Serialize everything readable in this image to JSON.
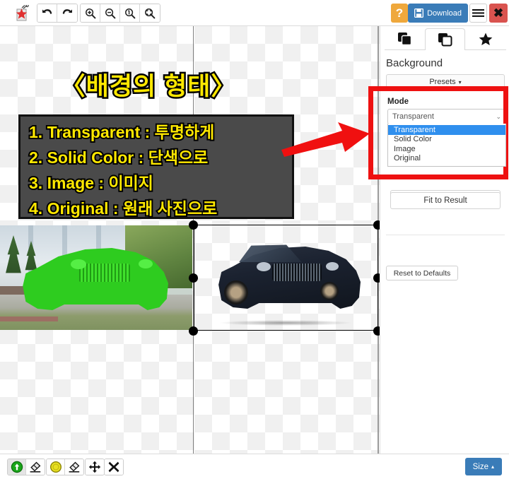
{
  "app": {
    "logo_icon": "magic-wand-star-icon"
  },
  "top_toolbar": {
    "undo": {
      "label": "Undo",
      "icon": "undo-arrow-icon"
    },
    "redo": {
      "label": "Redo",
      "icon": "redo-arrow-icon"
    },
    "zoom_in": {
      "label": "Zoom In",
      "icon": "magnifier-plus-icon"
    },
    "zoom_out": {
      "label": "Zoom Out",
      "icon": "magnifier-minus-icon"
    },
    "zoom_actual": {
      "label": "Actual Size",
      "icon": "magnifier-one-icon"
    },
    "zoom_fit": {
      "label": "Fit to Screen",
      "icon": "magnifier-fit-icon"
    },
    "help_label": "?",
    "download_label": "Download",
    "download_icon": "floppy-disk-icon",
    "menu_icon": "hamburger-menu-icon",
    "close_label": "✖"
  },
  "overlay": {
    "title": "〈배경의 형태〉",
    "lines": [
      "1. Transparent : 투명하게",
      "2. Solid Color : 단색으로",
      "3. Image : 이미지",
      "4. Original : 원래 사진으로"
    ],
    "arrow_icon": "red-arrow-right-icon",
    "text_color": "#ffe800",
    "box_color": "#4a4a4a",
    "highlight_color": "#ee1111"
  },
  "canvas": {
    "left_pane_name": "original-image-with-green-mask",
    "right_pane_name": "result-image-transparent-background"
  },
  "right_panel": {
    "tabs": [
      {
        "name": "tab-erase",
        "icon": "layers-filled-icon",
        "active": false
      },
      {
        "name": "tab-background",
        "icon": "layers-outline-icon",
        "active": true
      },
      {
        "name": "tab-effects",
        "icon": "star-icon",
        "active": false
      }
    ],
    "heading": "Background",
    "presets_label": "Presets",
    "presets_caret": "▾",
    "mode": {
      "label": "Mode",
      "value": "Transparent",
      "caret": "⌄",
      "options": [
        "Transparent",
        "Solid Color",
        "Image",
        "Original"
      ],
      "selected_index": 0,
      "selected_bg": "#2f8fee"
    },
    "fit_to_result_label": "Fit to Result",
    "reset_label": "Reset to Defaults"
  },
  "bottom_toolbar": {
    "tools": [
      {
        "name": "restore-brush",
        "icon": "green-plus-circle-icon",
        "active": true
      },
      {
        "name": "erase-brush",
        "icon": "eraser-icon",
        "active": false
      },
      {
        "name": "color-pick",
        "icon": "yellow-circle-icon",
        "active": false
      },
      {
        "name": "color-erase",
        "icon": "eraser-icon",
        "active": false
      },
      {
        "name": "move-tool",
        "icon": "move-arrows-icon",
        "active": false
      },
      {
        "name": "delete-tool",
        "icon": "cross-x-icon",
        "active": false
      }
    ],
    "size_label": "Size",
    "size_caret": "▴"
  }
}
